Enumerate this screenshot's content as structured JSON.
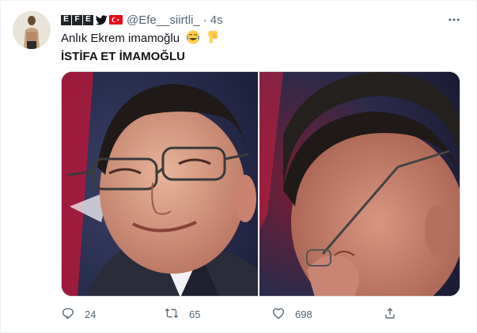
{
  "tweet": {
    "author": {
      "name_letters": [
        "E",
        "F",
        "E"
      ],
      "handle": "@Efe__siirtli_",
      "separator": "·",
      "time": "4s"
    },
    "text_line1": "Anlık Ekrem imamoğlu",
    "text_line2": "İSTİFA ET İMAMOĞLU",
    "emojis": [
      "face-with-tears-of-joy",
      "backhand-index-pointing-down"
    ],
    "stats": {
      "replies": "24",
      "retweets": "65",
      "likes": "698"
    }
  },
  "colors": {
    "text_primary": "#0f1419",
    "text_secondary": "#536471",
    "border": "#cfd9de",
    "flag_red": "#e30a17"
  },
  "icons": [
    "more-icon",
    "twitter-bird-icon",
    "turkey-flag-icon",
    "reply-icon",
    "retweet-icon",
    "like-icon",
    "share-icon"
  ]
}
